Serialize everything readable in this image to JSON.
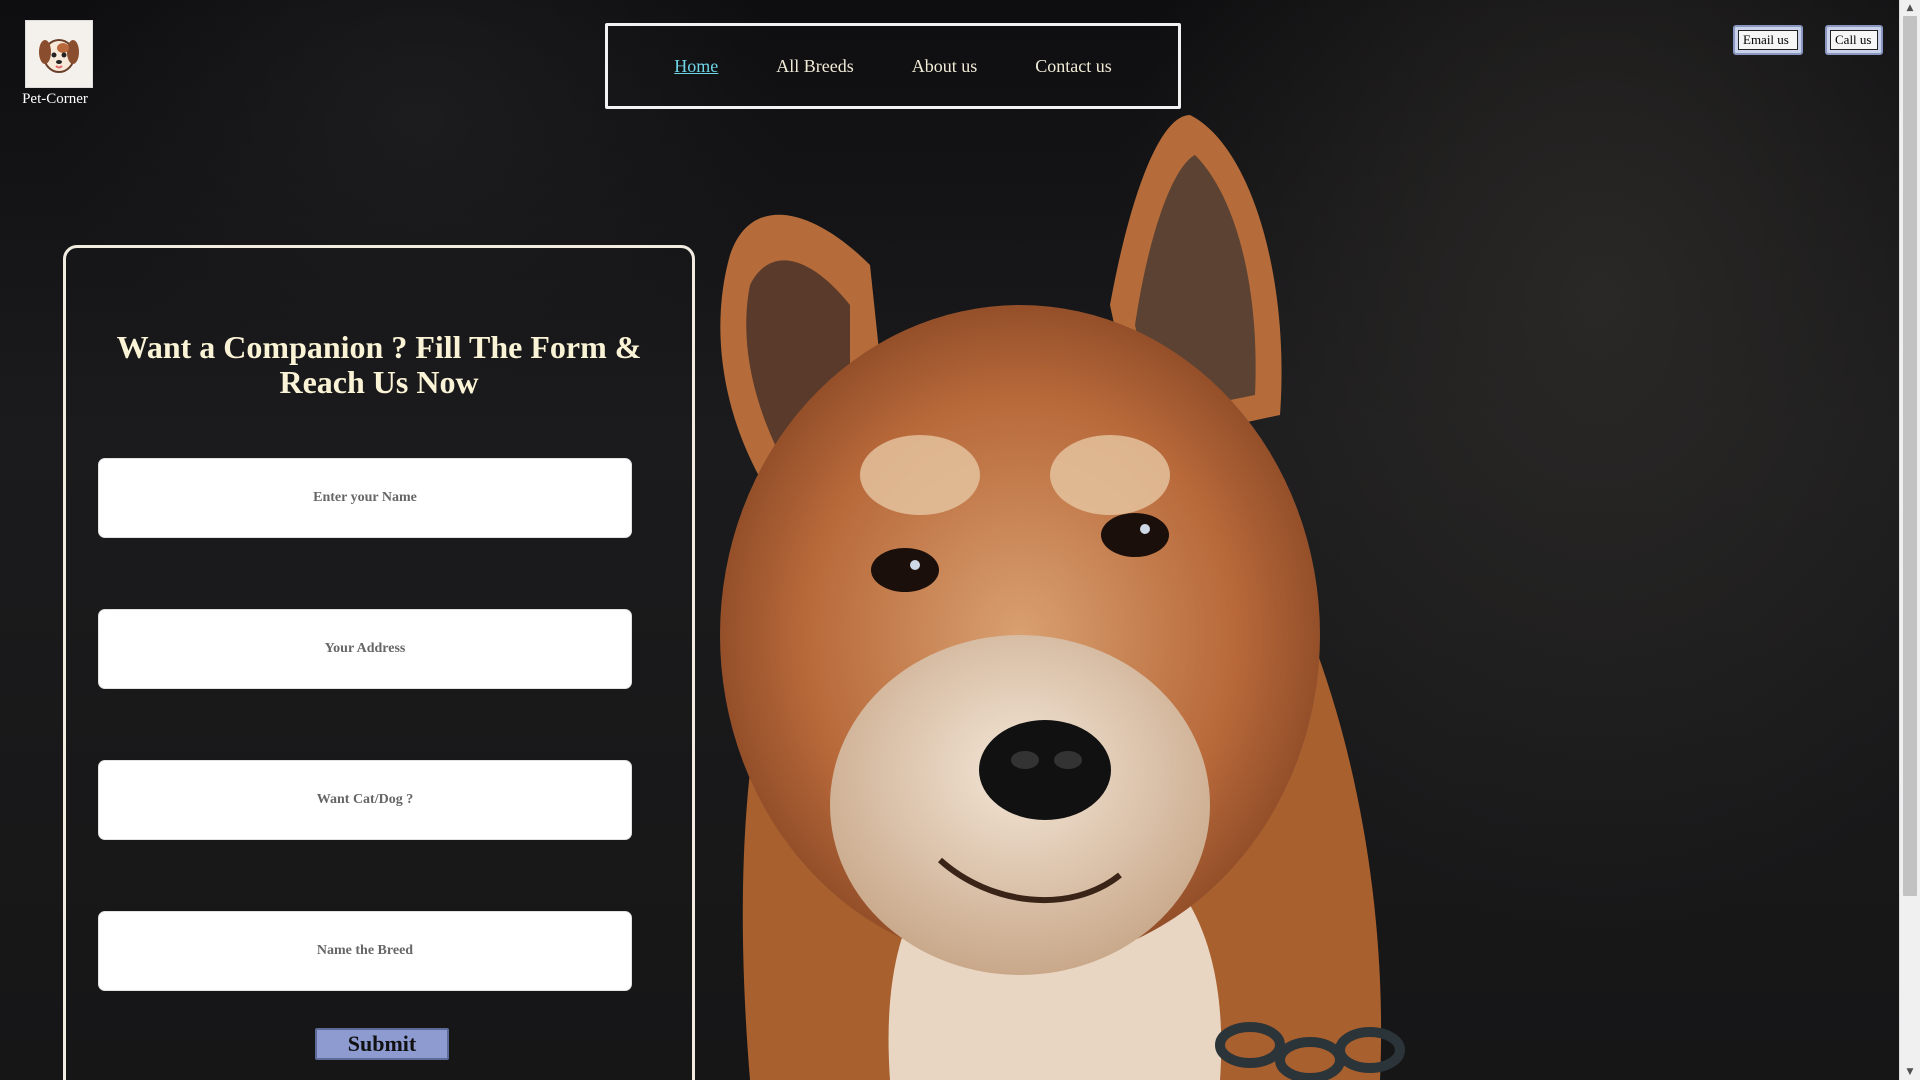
{
  "logo": {
    "label": "Pet-Corner",
    "icon": "puppy-logo-icon"
  },
  "nav": {
    "items": [
      {
        "label": "Home",
        "active": true
      },
      {
        "label": "All Breeds",
        "active": false
      },
      {
        "label": "About us",
        "active": false
      },
      {
        "label": "Contact us",
        "active": false
      }
    ]
  },
  "contact_buttons": {
    "email_label": "Email us",
    "call_label": "Call us"
  },
  "form": {
    "heading": "Want a Companion ? Fill The Form & Reach Us Now",
    "fields": [
      {
        "placeholder": "Enter your Name"
      },
      {
        "placeholder": "Your Address"
      },
      {
        "placeholder": "Want Cat/Dog ?"
      },
      {
        "placeholder": "Name the Breed"
      }
    ],
    "submit_label": "Submit"
  },
  "colors": {
    "heading": "#fbf3d6",
    "nav_active": "#6fd4e6",
    "submit_bg": "#8d9bd0",
    "button_bg": "#c9d2ea"
  }
}
